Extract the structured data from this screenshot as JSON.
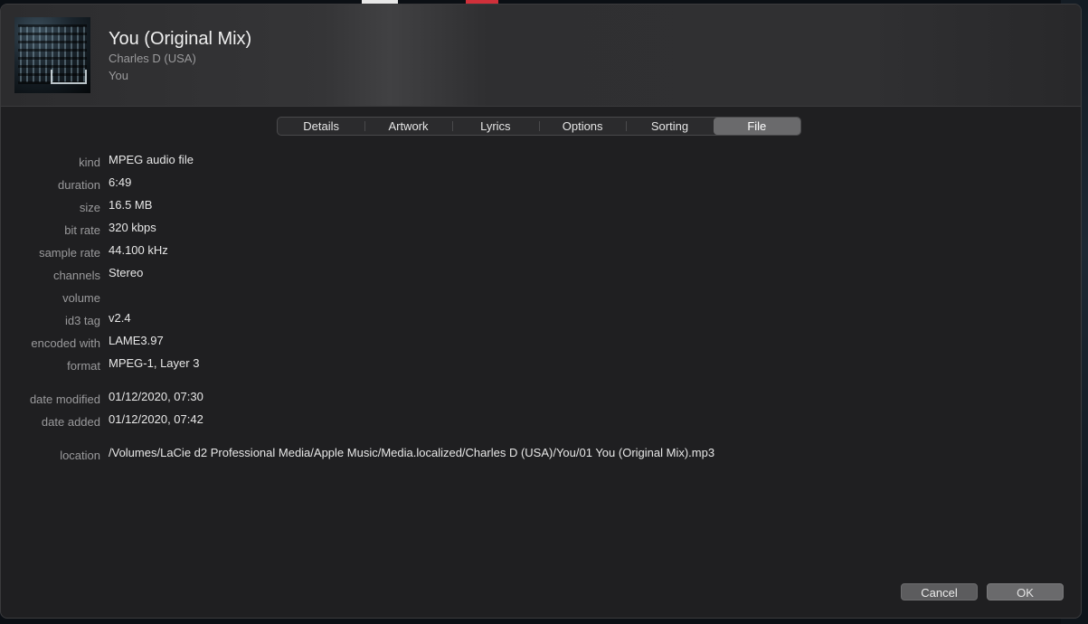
{
  "track": {
    "title": "You (Original Mix)",
    "artist": "Charles D (USA)",
    "album": "You"
  },
  "tabs": [
    {
      "label": "Details",
      "active": false
    },
    {
      "label": "Artwork",
      "active": false
    },
    {
      "label": "Lyrics",
      "active": false
    },
    {
      "label": "Options",
      "active": false
    },
    {
      "label": "Sorting",
      "active": false
    },
    {
      "label": "File",
      "active": true
    }
  ],
  "fields": [
    {
      "label": "kind",
      "value": "MPEG audio file"
    },
    {
      "label": "duration",
      "value": "6:49"
    },
    {
      "label": "size",
      "value": "16.5 MB"
    },
    {
      "label": "bit rate",
      "value": "320 kbps"
    },
    {
      "label": "sample rate",
      "value": "44.100 kHz"
    },
    {
      "label": "channels",
      "value": "Stereo"
    },
    {
      "label": "volume",
      "value": ""
    },
    {
      "label": "id3 tag",
      "value": "v2.4"
    },
    {
      "label": "encoded with",
      "value": "LAME3.97"
    },
    {
      "label": "format",
      "value": "MPEG-1, Layer 3"
    },
    {
      "label": "date modified",
      "value": "01/12/2020, 07:30"
    },
    {
      "label": "date added",
      "value": "01/12/2020, 07:42"
    },
    {
      "label": "location",
      "value": "/Volumes/LaCie d2 Professional Media/Apple Music/Media.localized/Charles D (USA)/You/01 You (Original Mix).mp3"
    }
  ],
  "buttons": {
    "cancel": "Cancel",
    "ok": "OK"
  }
}
